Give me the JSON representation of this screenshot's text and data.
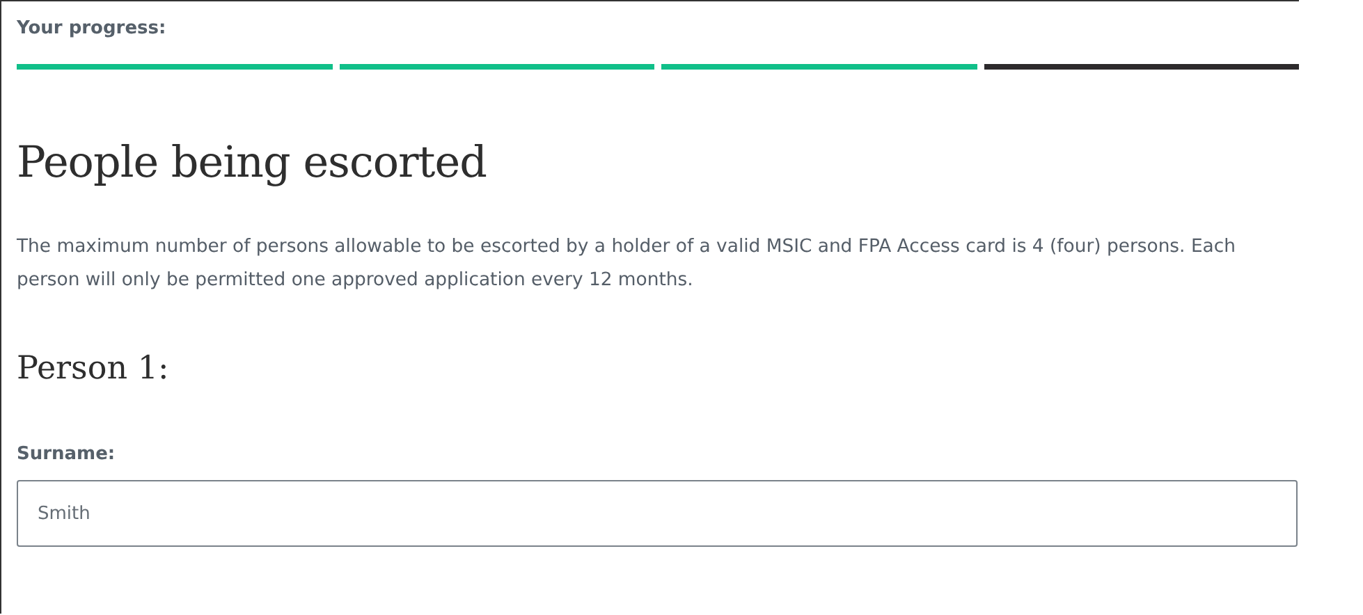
{
  "progress": {
    "label": "Your progress:",
    "steps": [
      {
        "complete": true
      },
      {
        "complete": true
      },
      {
        "complete": true
      },
      {
        "complete": false
      }
    ]
  },
  "heading": "People being escorted",
  "intro": "The maximum number of persons allowable to be escorted by a holder of a valid MSIC and FPA Access card is 4 (four) persons. Each person will only be permitted one approved application every 12 months.",
  "person": {
    "title": "Person 1:",
    "fields": [
      {
        "label": "Surname:",
        "value": "Smith"
      }
    ]
  }
}
